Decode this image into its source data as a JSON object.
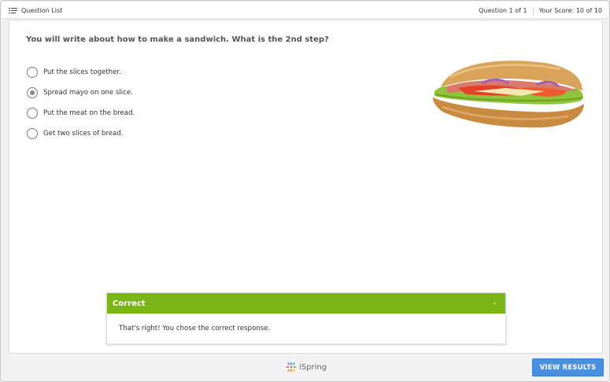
{
  "topbar": {
    "question_list_label": "Question List",
    "question_counter": "Question 1 of 1",
    "score": "Your Score: 10 of 10"
  },
  "question": {
    "text": "You will write about how to make a sandwich. What is the 2nd step?",
    "choices": [
      {
        "label": "Put the slices together.",
        "selected": false
      },
      {
        "label": "Spread mayo on one slice.",
        "selected": true
      },
      {
        "label": "Put the meat on the bread.",
        "selected": false
      },
      {
        "label": "Get two slices of bread.",
        "selected": false
      }
    ]
  },
  "feedback": {
    "title": "Correct",
    "message": "That's right! You chose the correct response.",
    "header_color": "#7cb518"
  },
  "footer": {
    "brand": "iSpring",
    "view_results_label": "VIEW RESULTS",
    "button_color": "#4a90e2"
  },
  "icons": [
    "list-icon",
    "sandwich-image",
    "chevron-down-icon",
    "ispring-logo-icon"
  ]
}
